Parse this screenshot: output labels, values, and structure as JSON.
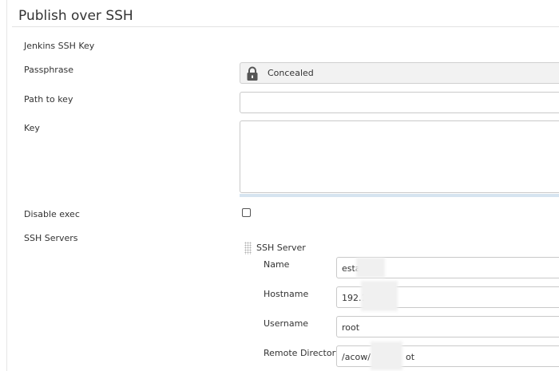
{
  "section": {
    "title": "Publish over SSH"
  },
  "labels": {
    "jenkins_ssh_key": "Jenkins SSH Key",
    "passphrase": "Passphrase",
    "path_to_key": "Path to key",
    "key": "Key",
    "disable_exec": "Disable exec",
    "ssh_servers": "SSH Servers"
  },
  "passphrase": {
    "value": "Concealed",
    "icon": "lock-icon"
  },
  "path_to_key": {
    "value": ""
  },
  "key": {
    "value": ""
  },
  "disable_exec": {
    "checked": false
  },
  "ssh_server": {
    "heading": "SSH Server",
    "name": {
      "label": "Name",
      "value": "esta"
    },
    "hostname": {
      "label": "Hostname",
      "value": "192.1"
    },
    "username": {
      "label": "Username",
      "value": "root"
    },
    "remote_directory": {
      "label": "Remote Directory",
      "value": "/acow/",
      "value_suffix": "ot"
    }
  },
  "colors": {
    "border": "#c9c9c9",
    "concealed_bg": "#f2f2f2",
    "lock": "#555555"
  }
}
